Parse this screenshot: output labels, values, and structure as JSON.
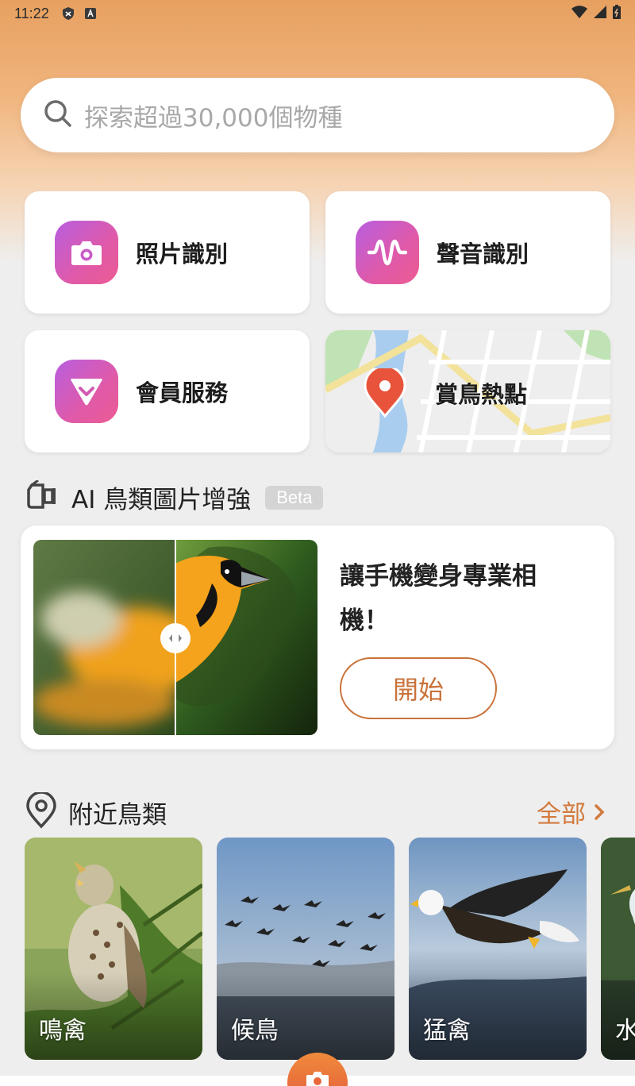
{
  "status": {
    "time": "11:22"
  },
  "search": {
    "placeholder": "探索超過30,000個物種"
  },
  "features": {
    "photo_id": "照片識別",
    "sound_id": "聲音識別",
    "membership": "會員服務",
    "hotspots": "賞鳥熱點"
  },
  "ai_section": {
    "title": "AI 鳥類圖片增強",
    "badge": "Beta",
    "promo_text": "讓手機變身專業相機！",
    "start_label": "開始"
  },
  "nearby": {
    "title": "附近鳥類",
    "see_all": "全部",
    "categories": [
      "鳴禽",
      "候鳥",
      "猛禽",
      "水"
    ]
  },
  "colors": {
    "accent": "#d27a3e",
    "icon_gradient_start": "#b85ee0",
    "icon_gradient_end": "#ec5b93"
  }
}
